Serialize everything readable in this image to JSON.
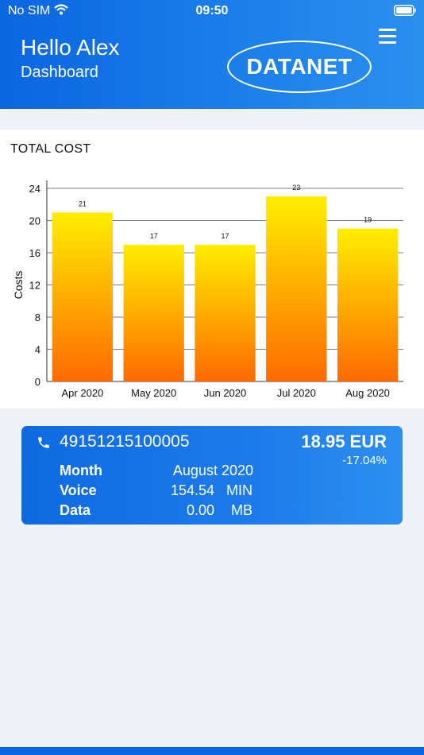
{
  "status_bar": {
    "carrier": "No SIM",
    "time": "09:50"
  },
  "header": {
    "greeting": "Hello Alex",
    "subtitle": "Dashboard",
    "logo": "DATANET",
    "menu_icon": "hamburger-menu-icon"
  },
  "total_cost": {
    "title": "TOTAL COST",
    "chart_data": {
      "type": "bar",
      "categories": [
        "Apr 2020",
        "May 2020",
        "Jun 2020",
        "Jul 2020",
        "Aug 2020"
      ],
      "values": [
        21,
        17,
        17,
        23,
        19
      ],
      "ylabel": "Costs",
      "xlabel": "",
      "ylim": [
        0,
        24
      ],
      "yticks": [
        0,
        4,
        8,
        12,
        16,
        20,
        24
      ],
      "grid": true,
      "bar_gradient": [
        "#ffee00",
        "#ff6a00"
      ]
    }
  },
  "line_card": {
    "phone_icon": "phone-icon",
    "number": "49151215100005",
    "amount": "18.95 EUR",
    "change": "-17.04%",
    "rows": [
      {
        "label": "Month",
        "value": "August 2020",
        "unit": ""
      },
      {
        "label": "Voice",
        "value": "154.54",
        "unit": "MIN"
      },
      {
        "label": "Data",
        "value": "0.00",
        "unit": "MB"
      }
    ]
  }
}
